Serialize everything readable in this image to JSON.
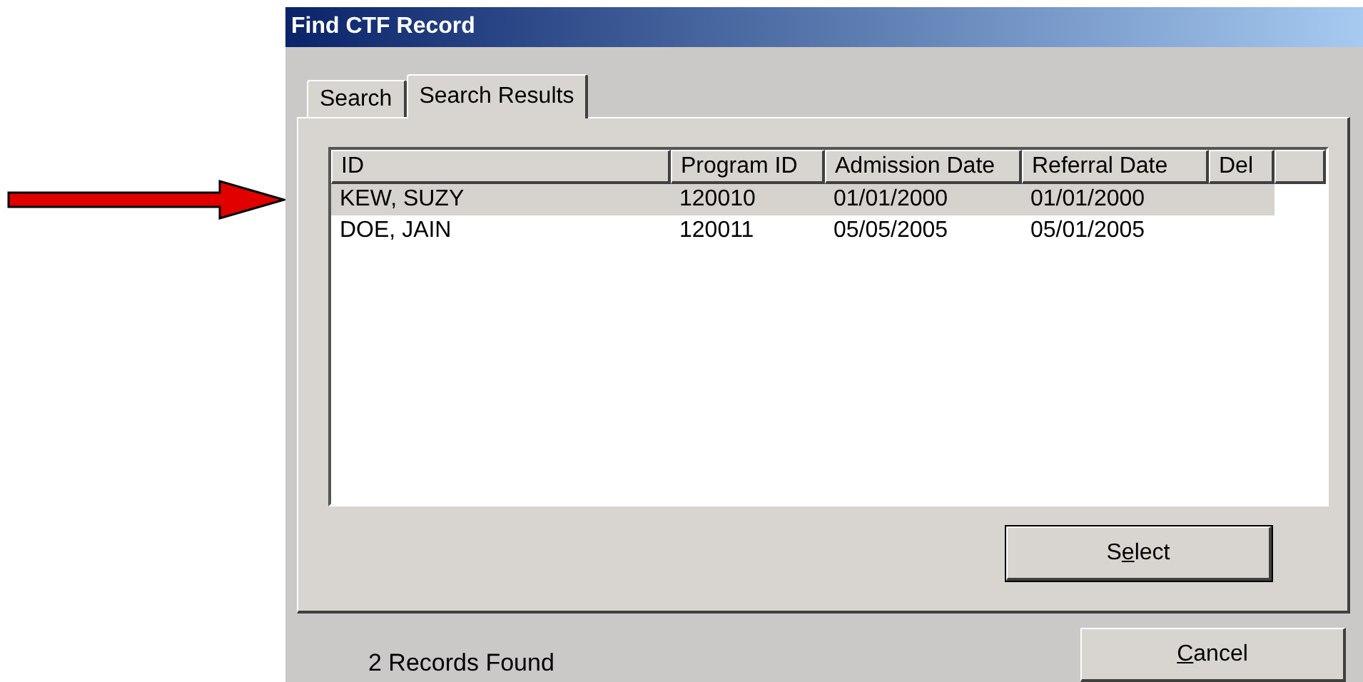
{
  "window": {
    "title": "Find CTF Record"
  },
  "tabs": [
    {
      "label": "Search",
      "selected": false
    },
    {
      "label": "Search Results",
      "selected": true
    }
  ],
  "table": {
    "columns": [
      "ID",
      "Program ID",
      "Admission Date",
      "Referral Date",
      "Del"
    ],
    "rows": [
      {
        "selected": true,
        "cells": [
          "KEW, SUZY",
          "120010",
          "01/01/2000",
          "01/01/2000",
          ""
        ]
      },
      {
        "selected": false,
        "cells": [
          "DOE, JAIN",
          "120011",
          "05/05/2005",
          "05/01/2005",
          ""
        ]
      }
    ]
  },
  "select_button": {
    "before": "S",
    "key": "e",
    "after": "lect"
  },
  "status": "2 Records Found",
  "cancel_button": {
    "key": "C",
    "after": "ancel"
  }
}
